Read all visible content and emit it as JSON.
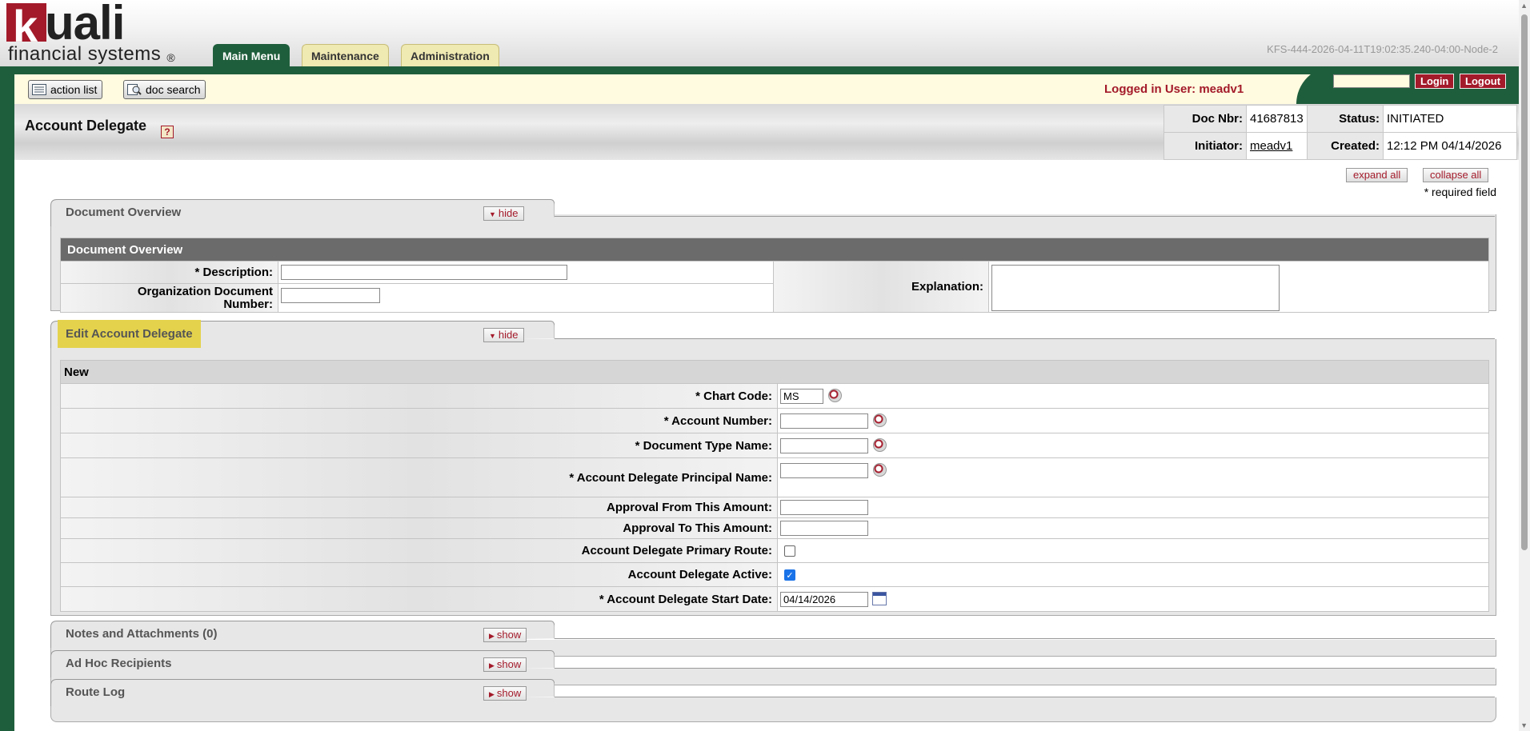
{
  "brand": {
    "wordmark": "kuali",
    "k_letter": "k",
    "rest_letters": "uali",
    "tagline": "financial systems",
    "registered": "®"
  },
  "tabs": [
    "Main Menu",
    "Maintenance",
    "Administration"
  ],
  "node_id": "KFS-444-2026-04-11T19:02:35.240-04:00-Node-2",
  "toolbar": {
    "action_list": "action list",
    "doc_search": "doc search",
    "logged_in": "Logged in User: meadv1",
    "login": "Login",
    "logout": "Logout"
  },
  "page": {
    "title": "Account Delegate",
    "help": "?"
  },
  "doc_info": {
    "doc_nbr_label": "Doc Nbr:",
    "doc_nbr": "41687813",
    "status_label": "Status:",
    "status": "INITIATED",
    "initiator_label": "Initiator:",
    "initiator": "meadv1",
    "created_label": "Created:",
    "created": "12:12 PM 04/14/2026"
  },
  "controls": {
    "expand_all": "expand all",
    "collapse_all": "collapse all",
    "required_note": "* required field"
  },
  "document_overview": {
    "tab_title": "Document Overview",
    "toggle": "hide",
    "header": "Document Overview",
    "description_label": "*  Description:",
    "description_value": "",
    "org_doc_label_1": "Organization Document",
    "org_doc_label_2": "Number:",
    "org_doc_value": "",
    "explanation_label": "Explanation:",
    "explanation_value": ""
  },
  "edit_delegate": {
    "tab_title": "Edit Account Delegate",
    "toggle": "hide",
    "subheader": "New",
    "chart_code_label": "*  Chart Code:",
    "chart_code_value": "MS",
    "account_number_label": "*  Account Number:",
    "account_number_value": "",
    "doc_type_label": "*  Document Type Name:",
    "doc_type_value": "",
    "principal_label": "*  Account Delegate Principal Name:",
    "principal_value": "",
    "approval_from_label": "Approval From This Amount:",
    "approval_from_value": "",
    "approval_to_label": "Approval To This Amount:",
    "approval_to_value": "",
    "primary_route_label": "Account Delegate Primary Route:",
    "primary_route_checked": false,
    "active_label": "Account Delegate Active:",
    "active_checked": true,
    "start_date_label": "*  Account Delegate Start Date:",
    "start_date_value": "04/14/2026"
  },
  "collapsed_panels": [
    {
      "title": "Notes and Attachments (0)",
      "toggle": "show"
    },
    {
      "title": "Ad Hoc Recipients",
      "toggle": "show"
    },
    {
      "title": "Route Log",
      "toggle": "show"
    }
  ],
  "colors": {
    "brand_green": "#1f5e3c",
    "brand_red": "#a31a2a",
    "toolbar_bg": "#fffbe0",
    "highlight": "#e4d24d"
  }
}
